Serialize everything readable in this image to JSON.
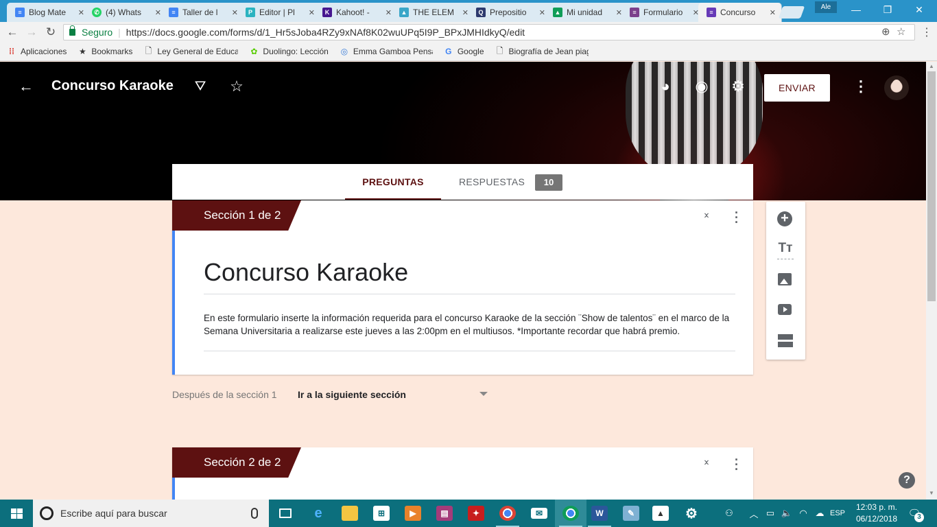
{
  "browser": {
    "tabs": [
      {
        "title": "Blog Mate",
        "icon": "docs-icon",
        "color": "#4285f4"
      },
      {
        "title": "(4) Whats",
        "icon": "whatsapp-icon",
        "color": "#25d366"
      },
      {
        "title": "Taller de l",
        "icon": "docs-icon",
        "color": "#4285f4"
      },
      {
        "title": "Editor | Pl",
        "icon": "piktochart-icon",
        "color": "#2bb3c0"
      },
      {
        "title": "Kahoot! -",
        "icon": "kahoot-icon",
        "color": "#46178f"
      },
      {
        "title": "THE ELEM",
        "icon": "page-icon",
        "color": "#3aa6c8"
      },
      {
        "title": "Prepositio",
        "icon": "quizlet-icon",
        "color": "#2d3a6e"
      },
      {
        "title": "Mi unidad",
        "icon": "drive-icon",
        "color": "#0f9d58"
      },
      {
        "title": "Formulario",
        "icon": "forms-icon",
        "color": "#7b3f8c"
      },
      {
        "title": "Concurso",
        "icon": "forms-icon",
        "color": "#673ab7"
      }
    ],
    "user_badge": "Ale",
    "secure_label": "Seguro",
    "url": "https://docs.google.com/forms/d/1_Hr5sJoba4RZy9xNAf8K02wuUPq5I9P_BPxJMHIdkyQ/edit",
    "bookmarks": [
      {
        "label": "Aplicaciones",
        "icon": "apps-grid-icon"
      },
      {
        "label": "Bookmarks",
        "icon": "star-icon"
      },
      {
        "label": "Ley General de Educac",
        "icon": "page-icon"
      },
      {
        "label": "Duolingo: Lección",
        "icon": "duolingo-icon"
      },
      {
        "label": "Emma Gamboa Pensa",
        "icon": "globe-icon"
      },
      {
        "label": "Google",
        "icon": "google-icon"
      },
      {
        "label": "Biografía de Jean piag",
        "icon": "page-icon"
      }
    ]
  },
  "forms": {
    "header_title": "Concurso Karaoke",
    "send_label": "ENVIAR",
    "tabs": {
      "questions": "PREGUNTAS",
      "responses": "RESPUESTAS",
      "responses_count": "10"
    },
    "section1": {
      "tag": "Sección 1 de 2",
      "title": "Concurso Karaoke",
      "description": "En este formulario inserte la información requerida para el concurso Karaoke de la sección ¨Show de talentos¨ en el marco de la Semana Universitaria a realizarse este jueves a las 2:00pm en el multiusos. *Importante recordar que habrá premio."
    },
    "after_section": {
      "label": "Después de la sección 1",
      "value": "Ir a la siguiente sección"
    },
    "section2": {
      "tag": "Sección 2 de 2"
    },
    "theme_color": "#5d1111",
    "background_color": "#fde8dc"
  },
  "taskbar": {
    "search_placeholder": "Escribe aquí para buscar",
    "language": "ESP",
    "time": "12:03 p. m.",
    "date": "06/12/2018",
    "notifications": "3"
  }
}
